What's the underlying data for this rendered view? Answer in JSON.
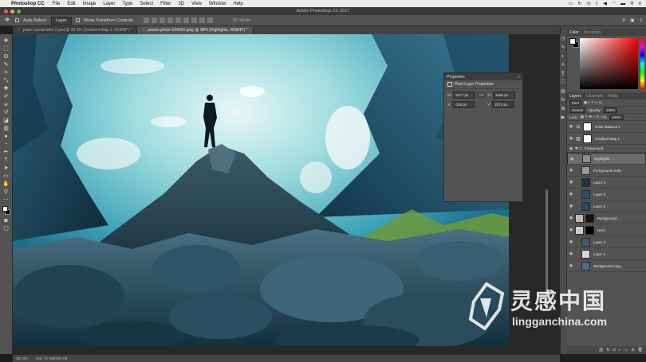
{
  "menubar": {
    "app_name": "Photoshop CC",
    "items": [
      "File",
      "Edit",
      "Image",
      "Layer",
      "Type",
      "Select",
      "Filter",
      "3D",
      "View",
      "Window",
      "Help"
    ]
  },
  "window": {
    "title": "Adobe Photoshop CC 2017"
  },
  "options": {
    "auto_select_label": "Auto-Select:",
    "auto_select_value": "Layer",
    "transform_label": "Show Transform Controls",
    "mode_3d": "3D Mode:"
  },
  "tabs": [
    {
      "label": "polar coordinates 2.psd @ 33.3% (Gradient Map 1, RGB/8*) *",
      "active": false
    },
    {
      "label": "pexels-photo-144352.jpeg @ 38% (Highlights, RGB/8*) *",
      "active": true
    }
  ],
  "properties": {
    "tab": "Properties",
    "subtitle": "Pixel Layer Properties",
    "w_label": "W:",
    "w_value": "5377 px",
    "h_label": "H:",
    "h_value": "1666 px",
    "x_label": "X:",
    "x_value": "-100 px",
    "y_label": "Y:",
    "y_value": "2074 px",
    "link_label": "GO"
  },
  "color_panel": {
    "tab_color": "Color",
    "tab_swatches": "Swatches"
  },
  "layers_panel": {
    "tab_layers": "Layers",
    "tab_channels": "Channels",
    "tab_paths": "Paths",
    "kind_label": "Kind",
    "blend_mode": "Screen",
    "opacity_label": "Opacity:",
    "opacity_value": "100%",
    "lock_label": "Lock:",
    "fill_label": "Fill:",
    "fill_value": "100%",
    "layers": [
      {
        "name": "Color Balance 1",
        "type": "adjustment",
        "thumb": "#ffffff",
        "selected": false
      },
      {
        "name": "Gradient Map 1",
        "type": "adjustment",
        "thumb": "#ffffff",
        "selected": false
      },
      {
        "name": "Foreground",
        "type": "group",
        "thumb": "#555555",
        "selected": false
      },
      {
        "name": "Highlights",
        "type": "pixel",
        "thumb": "#8d8d8d",
        "selected": true
      },
      {
        "name": "Foreground rocks",
        "type": "pixel",
        "thumb": "#9a9a9a",
        "selected": false
      },
      {
        "name": "Layer 4",
        "type": "pixel",
        "thumb": "#1f3447",
        "selected": false
      },
      {
        "name": "Layer 5",
        "type": "pixel",
        "thumb": "#2b4e6d",
        "selected": false
      },
      {
        "name": "Layer 3",
        "type": "pixel",
        "thumb": "#214a66",
        "selected": false
      },
      {
        "name": "Background...",
        "type": "masked",
        "thumb": "#bbbbbb",
        "selected": false
      },
      {
        "name": "Hero",
        "type": "masked",
        "thumb": "#cccccc",
        "selected": false
      },
      {
        "name": "Layer 2",
        "type": "pixel",
        "thumb": "#3a5a78",
        "selected": false
      },
      {
        "name": "Layer 1",
        "type": "pixel",
        "thumb": "#d8d8d8",
        "selected": false
      },
      {
        "name": "Background copy",
        "type": "pixel",
        "thumb": "#4a6c88",
        "selected": false
      }
    ]
  },
  "status": {
    "zoom": "38.03%",
    "doc": "Doc: 57.9M/400.4M"
  },
  "watermark": {
    "cn": "灵感中国",
    "en": "lingganchina.com"
  }
}
